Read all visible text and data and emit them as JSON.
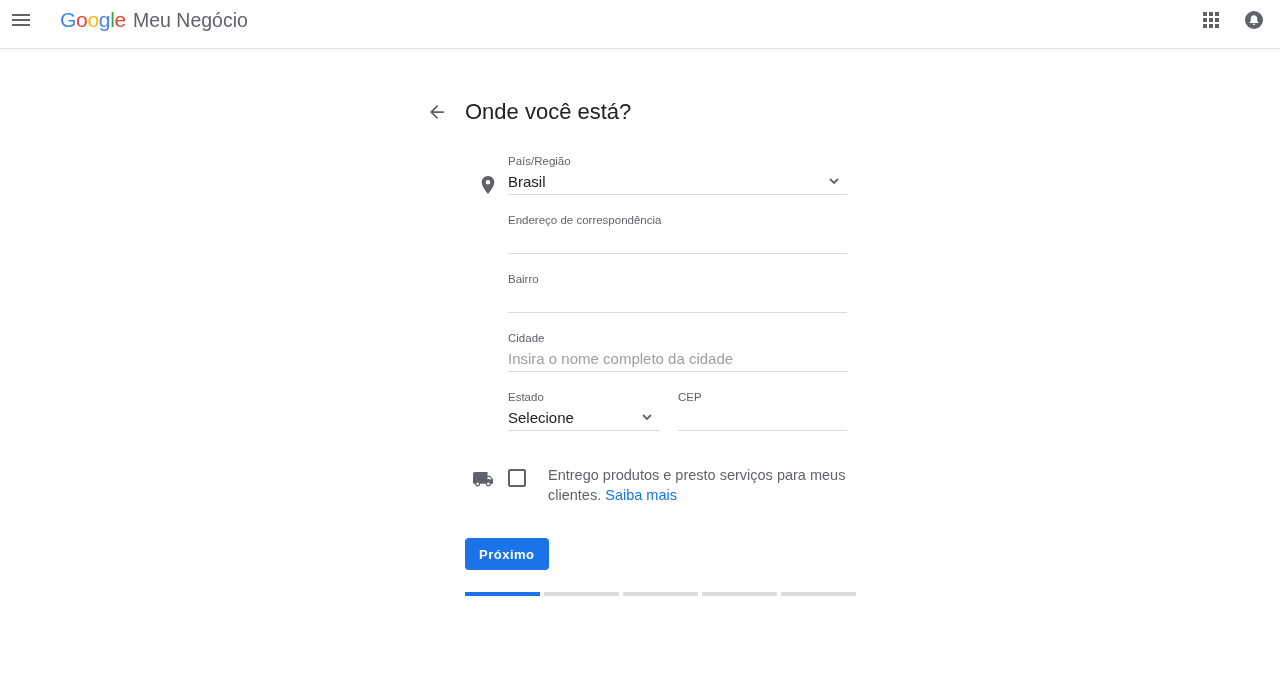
{
  "header": {
    "logo": "Google",
    "app_name": "Meu Negócio"
  },
  "page": {
    "title": "Onde você está?"
  },
  "form": {
    "rows": [
      [
        {
          "kind": "select",
          "label": "País/Região",
          "value": "Brasil"
        }
      ],
      [
        {
          "kind": "text",
          "label": "Endereço de correspondência"
        }
      ],
      [
        {
          "kind": "text",
          "label": "Bairro"
        }
      ],
      [
        {
          "kind": "text",
          "label": "Cidade",
          "placeholder": "Insira o nome completo da cidade"
        }
      ],
      [
        {
          "kind": "select",
          "label": "Estado",
          "value": "Selecione"
        },
        {
          "kind": "text",
          "label": "CEP"
        }
      ]
    ]
  },
  "delivery": {
    "checked": false,
    "text": "Entrego produtos e presto serviços para meus clientes.",
    "link": "Saiba mais"
  },
  "next_button": "Próximo",
  "progress": {
    "steps": [
      {
        "active": true
      },
      {
        "active": false
      },
      {
        "active": false
      },
      {
        "active": false
      },
      {
        "active": false
      }
    ]
  }
}
